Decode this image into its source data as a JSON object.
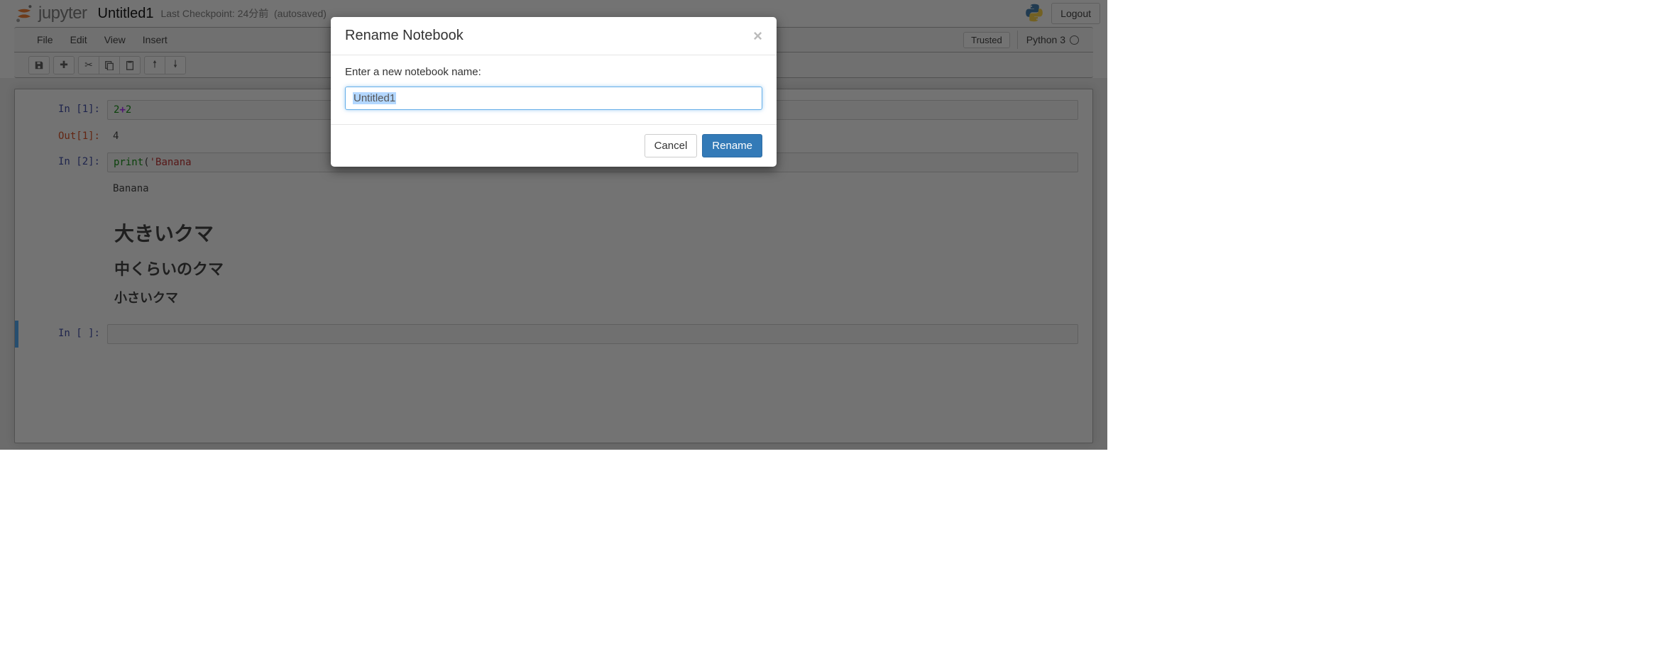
{
  "header": {
    "logo_text": "jupyter",
    "notebook_name": "Untitled1",
    "checkpoint": "Last Checkpoint: 24分前",
    "autosaved": "(autosaved)",
    "logout": "Logout"
  },
  "menubar": {
    "items": [
      "File",
      "Edit",
      "View",
      "Insert"
    ],
    "trusted": "Trusted",
    "kernel": "Python 3"
  },
  "cells": [
    {
      "in_prompt": "In [1]:",
      "code_html": "<span class='code-num'>2</span><span class='code-op'>+</span><span class='code-num'>2</span>",
      "out_prompt": "Out[1]:",
      "out_text": "4"
    },
    {
      "in_prompt": "In [2]:",
      "code_html": "<span class='code-fn'>print</span>(<span class='code-str'>'Banana</span>",
      "out_text": "Banana"
    }
  ],
  "markdown": {
    "h1": "大きいクマ",
    "h2": "中くらいのクマ",
    "h3": "小さいクマ"
  },
  "empty_prompt": "In [ ]:",
  "modal": {
    "title": "Rename Notebook",
    "prompt": "Enter a new notebook name:",
    "value": "Untitled1",
    "cancel": "Cancel",
    "rename": "Rename"
  }
}
